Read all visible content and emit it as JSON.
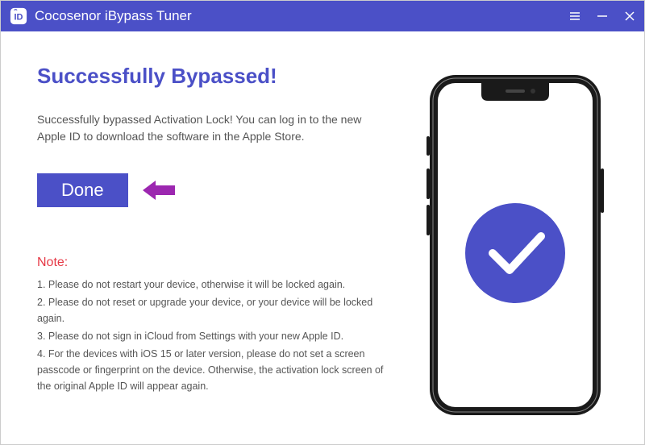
{
  "titlebar": {
    "app_title": "Cocosenor iBypass Tuner"
  },
  "main": {
    "heading": "Successfully Bypassed!",
    "message": "Successfully bypassed Activation Lock! You can log in to the new Apple ID to download the software in the Apple Store.",
    "done_label": "Done",
    "note_heading": "Note:",
    "notes": [
      "1. Please do not restart your device, otherwise it will be locked again.",
      "2. Please do not reset or upgrade your device, or your device will be locked again.",
      "3. Please do not sign in iCloud from Settings with your new Apple ID.",
      "4. For the devices with iOS 15 or later version, please do not set a screen passcode or fingerprint on the device. Otherwise, the activation lock screen of the original Apple ID will appear again."
    ]
  },
  "colors": {
    "accent": "#4b50c7",
    "danger": "#e63946",
    "arrow": "#9c27b0"
  }
}
